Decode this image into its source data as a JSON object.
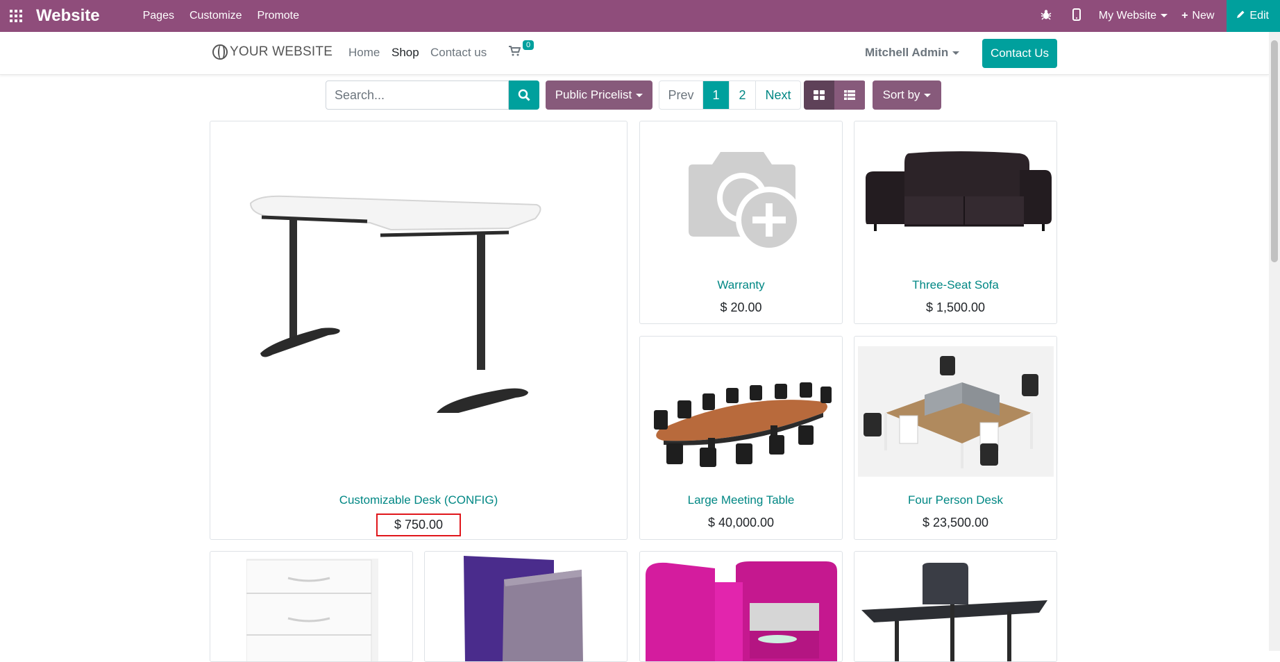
{
  "topbar": {
    "brand": "Website",
    "menu": [
      "Pages",
      "Customize",
      "Promote"
    ],
    "my_website": "My Website",
    "new": "New",
    "edit": "Edit",
    "bg_color": "#8f4d7b",
    "edit_color": "#00a09d"
  },
  "header": {
    "logo": "YOUR WEBSITE",
    "nav": {
      "home": "Home",
      "shop": "Shop",
      "contact": "Contact us"
    },
    "cart_count": "0",
    "user": "Mitchell Admin",
    "contact_button": "Contact Us"
  },
  "toolbar": {
    "search_placeholder": "Search...",
    "pricelist": "Public Pricelist",
    "pager": {
      "prev": "Prev",
      "page1": "1",
      "page2": "2",
      "next": "Next"
    },
    "sort": "Sort by"
  },
  "products": [
    {
      "name": "Customizable Desk (CONFIG)",
      "price": "$ 750.00",
      "highlighted": true
    },
    {
      "name": "Warranty",
      "price": "$ 20.00"
    },
    {
      "name": "Three-Seat Sofa",
      "price": "$ 1,500.00"
    },
    {
      "name": "Large Meeting Table",
      "price": "$ 40,000.00"
    },
    {
      "name": "Four Person Desk",
      "price": "$ 23,500.00"
    }
  ],
  "colors": {
    "accent": "#00a09d",
    "plum": "#875a7b",
    "link": "#008784",
    "highlight": "#e0161b"
  }
}
